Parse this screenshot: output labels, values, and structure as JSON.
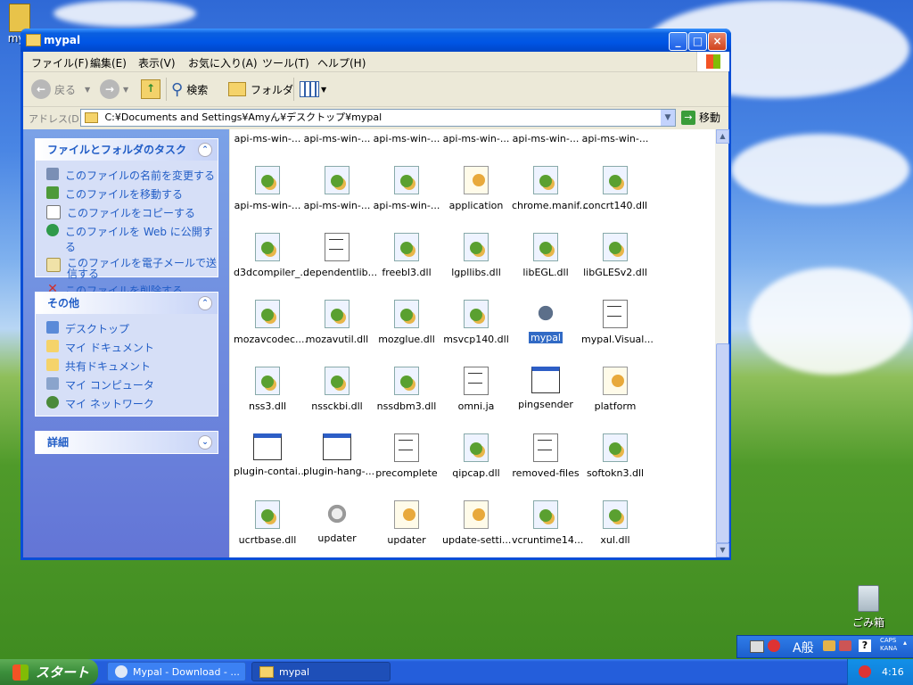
{
  "desktop": {
    "partial_icon_label": "myp",
    "recycle_bin_label": "ごみ箱"
  },
  "window": {
    "title": "mypal",
    "min_label": "_",
    "max_label": "□",
    "close_label": "×"
  },
  "menu": [
    "ファイル(F)",
    "編集(E)",
    "表示(V)",
    "お気に入り(A)",
    "ツール(T)",
    "ヘルプ(H)"
  ],
  "toolbar": {
    "back_label": "戻る",
    "search_label": "検索",
    "folder_label": "フォルダ"
  },
  "address": {
    "label": "アドレス(D)",
    "value": "C:¥Documents and Settings¥Amyん¥デスクトップ¥mypal",
    "go_label": "移動"
  },
  "tasks_panel": {
    "title": "ファイルとフォルダのタスク",
    "items": [
      "このファイルの名前を変更する",
      "このファイルを移動する",
      "このファイルをコピーする",
      "このファイルを Web に公開する",
      "このファイルを電子メールで送信する",
      "このファイルを削除する"
    ]
  },
  "other_panel": {
    "title": "その他",
    "items": [
      "デスクトップ",
      "マイ ドキュメント",
      "共有ドキュメント",
      "マイ コンピュータ",
      "マイ ネットワーク"
    ]
  },
  "details_panel": {
    "title": "詳細"
  },
  "files": [
    {
      "name": "api-ms-win-...",
      "kind": "dll"
    },
    {
      "name": "api-ms-win-...",
      "kind": "dll"
    },
    {
      "name": "api-ms-win-...",
      "kind": "dll"
    },
    {
      "name": "api-ms-win-...",
      "kind": "dll"
    },
    {
      "name": "api-ms-win-...",
      "kind": "dll"
    },
    {
      "name": "api-ms-win-...",
      "kind": "dll"
    },
    {
      "name": "api-ms-win-...",
      "kind": "dll"
    },
    {
      "name": "api-ms-win-...",
      "kind": "dll"
    },
    {
      "name": "api-ms-win-...",
      "kind": "dll"
    },
    {
      "name": "application",
      "kind": "cfg"
    },
    {
      "name": "chrome.manif...",
      "kind": "dll"
    },
    {
      "name": "concrt140.dll",
      "kind": "dll"
    },
    {
      "name": "d3dcompiler_...",
      "kind": "dll"
    },
    {
      "name": "dependentlib...",
      "kind": "txt"
    },
    {
      "name": "freebl3.dll",
      "kind": "dll"
    },
    {
      "name": "lgpllibs.dll",
      "kind": "dll"
    },
    {
      "name": "libEGL.dll",
      "kind": "dll"
    },
    {
      "name": "libGLESv2.dll",
      "kind": "dll"
    },
    {
      "name": "mozavcodec....",
      "kind": "dll"
    },
    {
      "name": "mozavutil.dll",
      "kind": "dll"
    },
    {
      "name": "mozglue.dll",
      "kind": "dll"
    },
    {
      "name": "msvcp140.dll",
      "kind": "dll"
    },
    {
      "name": "mypal",
      "kind": "mypal",
      "selected": true
    },
    {
      "name": "mypal.Visual...",
      "kind": "txt"
    },
    {
      "name": "nss3.dll",
      "kind": "dll"
    },
    {
      "name": "nssckbi.dll",
      "kind": "dll"
    },
    {
      "name": "nssdbm3.dll",
      "kind": "dll"
    },
    {
      "name": "omni.ja",
      "kind": "txt"
    },
    {
      "name": "pingsender",
      "kind": "exe"
    },
    {
      "name": "platform",
      "kind": "cfg"
    },
    {
      "name": "plugin-contai...",
      "kind": "exe"
    },
    {
      "name": "plugin-hang-...",
      "kind": "exe"
    },
    {
      "name": "precomplete",
      "kind": "txt"
    },
    {
      "name": "qipcap.dll",
      "kind": "dll"
    },
    {
      "name": "removed-files",
      "kind": "txt"
    },
    {
      "name": "softokn3.dll",
      "kind": "dll"
    },
    {
      "name": "ucrtbase.dll",
      "kind": "dll"
    },
    {
      "name": "updater",
      "kind": "upd"
    },
    {
      "name": "updater",
      "kind": "cfg"
    },
    {
      "name": "update-setti...",
      "kind": "cfg"
    },
    {
      "name": "vcruntime14...",
      "kind": "dll"
    },
    {
      "name": "xul.dll",
      "kind": "dll"
    }
  ],
  "taskbar": {
    "start_label": "スタート",
    "tasks": [
      "Mypal - Download - ...",
      "mypal"
    ],
    "clock": "4:16"
  },
  "langbar": {
    "ime_label": "A般",
    "caps": "CAPS",
    "kana": "KANA"
  }
}
